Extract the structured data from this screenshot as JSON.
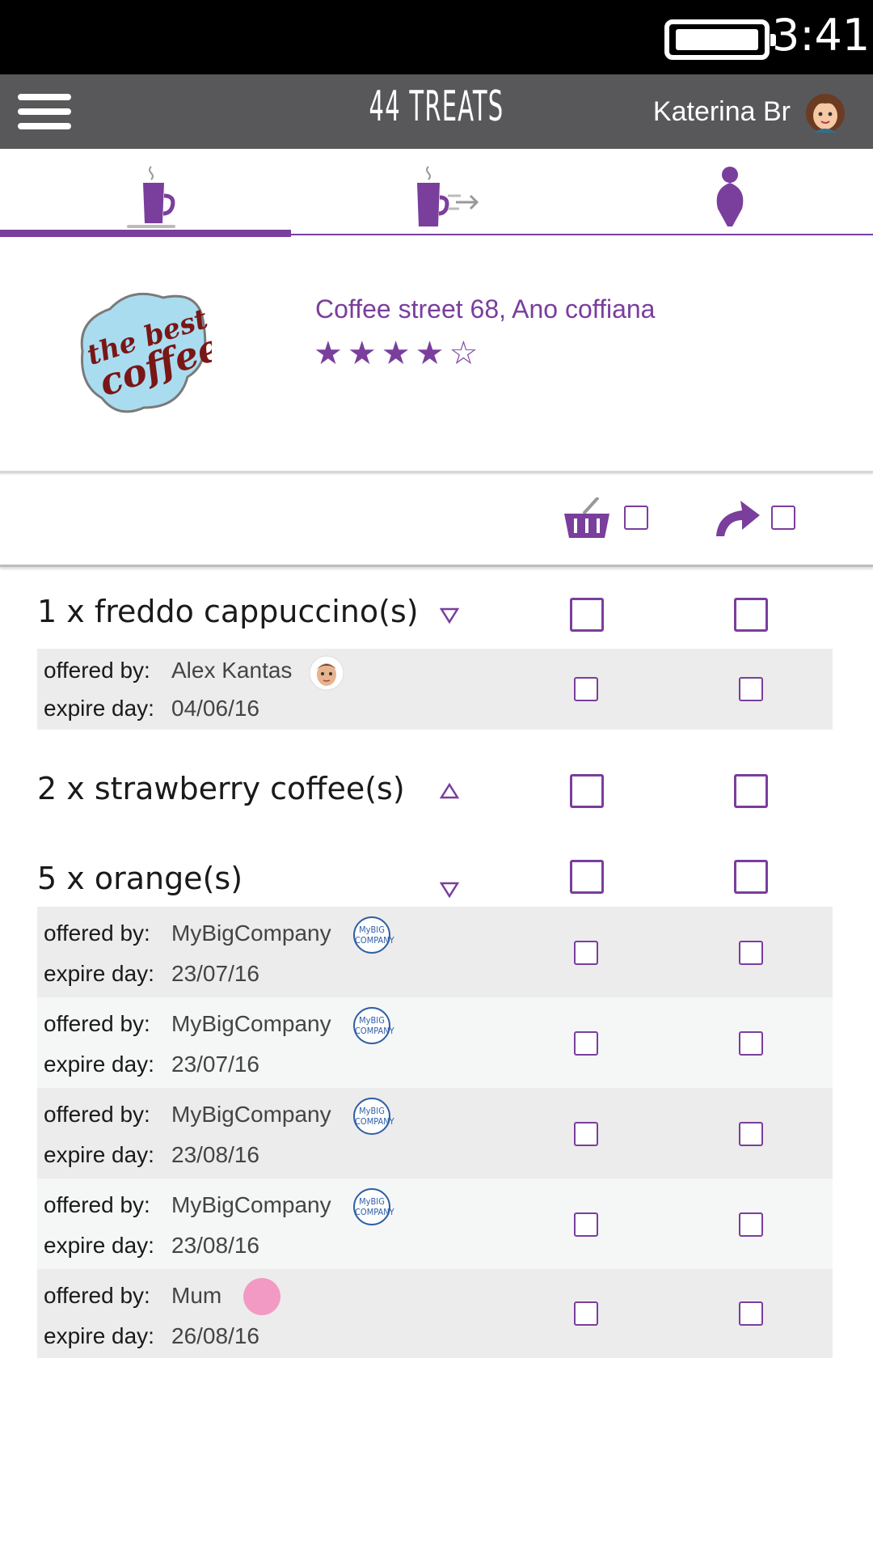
{
  "status_bar": {
    "time": "3:41"
  },
  "app_bar": {
    "title": "44 TREATS",
    "user_name": "Katerina Br"
  },
  "tabs": [
    {
      "icon": "coffee-cup-icon",
      "active": true
    },
    {
      "icon": "coffee-send-icon",
      "active": false
    },
    {
      "icon": "person-icon",
      "active": false
    }
  ],
  "shop": {
    "logo_text_line1": "the best",
    "logo_text_line2": "coffee",
    "address": "Coffee street 68, Ano coffiana",
    "rating": 4,
    "stars_text": "★★★★☆"
  },
  "columns": {
    "basket_icon": "basket-icon",
    "forward_icon": "forward-arrow-icon"
  },
  "labels": {
    "offered_by": "offered by:",
    "expire_day": "expire day:"
  },
  "items": [
    {
      "title": "1 x freddo cappuccino(s)",
      "expanded": true,
      "offers": [
        {
          "offered_by": "Alex Kantas",
          "expire_day": "04/06/16",
          "badge": "avatar"
        }
      ]
    },
    {
      "title": "2 x strawberry coffee(s)",
      "expanded": false,
      "offers": []
    },
    {
      "title": "5 x orange(s)",
      "expanded": true,
      "offers": [
        {
          "offered_by": "MyBigCompany",
          "expire_day": "23/07/16",
          "badge": "company-logo"
        },
        {
          "offered_by": "MyBigCompany",
          "expire_day": "23/07/16",
          "badge": "company-logo"
        },
        {
          "offered_by": "MyBigCompany",
          "expire_day": "23/08/16",
          "badge": "company-logo"
        },
        {
          "offered_by": "MyBigCompany",
          "expire_day": "23/08/16",
          "badge": "company-logo"
        },
        {
          "offered_by": "Mum",
          "expire_day": "26/08/16",
          "badge": "pink-dot"
        }
      ]
    }
  ],
  "company_badge_text": {
    "line1": "MyBIG",
    "line2": "COMPANY"
  },
  "colors": {
    "accent": "#7a3e9d",
    "appbar": "#58585a",
    "statusbar": "#000000",
    "company": "#2f5fa6",
    "mum": "#f29ac3"
  }
}
